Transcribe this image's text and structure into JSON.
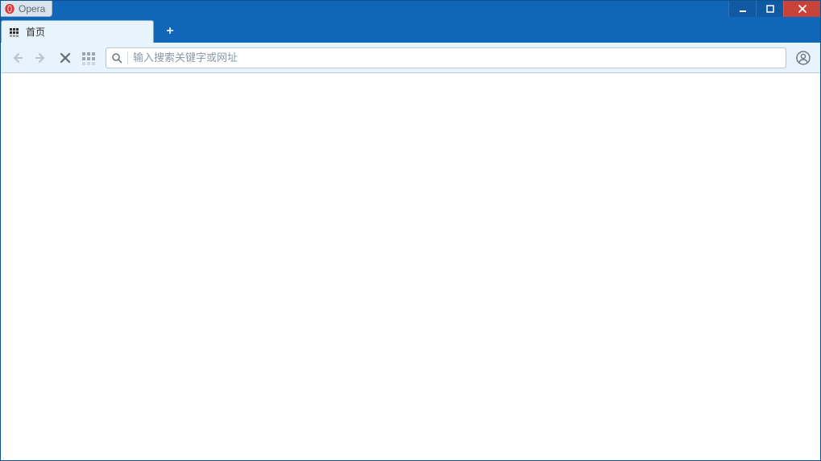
{
  "window": {
    "app_title": "Opera"
  },
  "tabs": {
    "active": {
      "label": "首页"
    }
  },
  "toolbar": {
    "address_placeholder": "输入搜索关键字或网址",
    "address_value": ""
  }
}
